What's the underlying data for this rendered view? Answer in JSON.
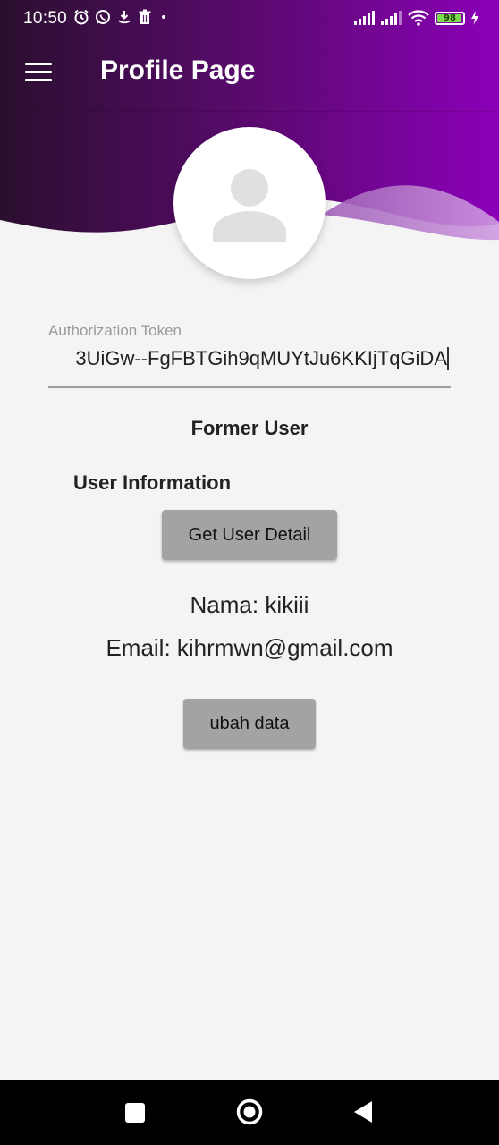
{
  "status_bar": {
    "time": "10:50",
    "left_icons": [
      "alarm-icon",
      "whatsapp-icon",
      "download-icon",
      "trash-icon",
      "dot-icon"
    ],
    "right_icons": [
      "signal-icon",
      "signal-icon",
      "wifi-icon",
      "battery-icon",
      "charging-icon"
    ],
    "battery_level": "98"
  },
  "appbar": {
    "title": "Profile Page",
    "menu_icon": "menu-icon"
  },
  "colors": {
    "header_dark": "#2a0f2e",
    "header_purple": "#8b00b8",
    "wave_light": "#c98fdb",
    "background": "#f4f4f4",
    "button": "#a3a3a3"
  },
  "avatar": {
    "icon": "person-icon"
  },
  "token_field": {
    "label": "Authorization Token",
    "value": "3UiGw--FgFBTGih9qMUYtJu6KKIjTqGiDA"
  },
  "main": {
    "former_user": "Former User",
    "user_info_heading": "User Information",
    "get_user_detail_label": "Get User Detail",
    "name_line": "Nama: kikiii",
    "email_line": "Email: kihrmwn@gmail.com",
    "edit_label": "ubah data"
  },
  "navbar": {
    "icons": [
      "recents-icon",
      "home-icon",
      "back-icon"
    ]
  }
}
